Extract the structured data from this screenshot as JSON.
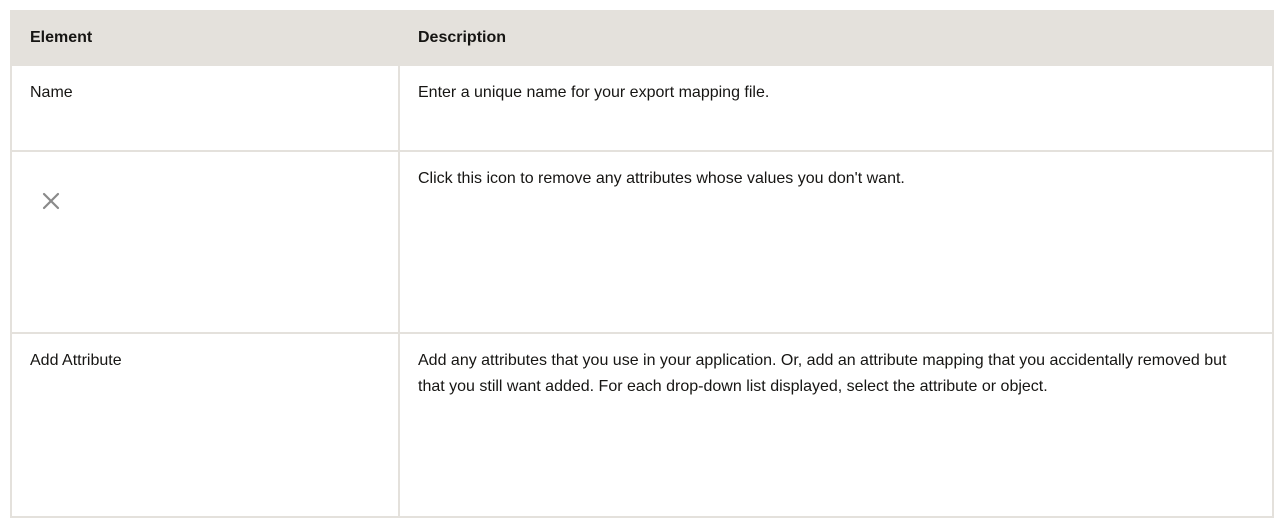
{
  "table": {
    "headers": [
      "Element",
      "Description"
    ],
    "rows": [
      {
        "element": "Name",
        "description": "Enter a unique name for your export mapping file."
      },
      {
        "element_icon": "close-icon",
        "description": "Click this icon to remove any attributes whose values you don't want."
      },
      {
        "element": "Add Attribute",
        "description": "Add any attributes that you use in your application. Or, add an attribute mapping that you accidentally removed but that you still want added. For each drop-down list displayed, select the attribute or object."
      }
    ]
  },
  "colors": {
    "header_bg": "#e4e1dc",
    "border": "#e4e1dc",
    "icon": "#8a8a8a"
  }
}
